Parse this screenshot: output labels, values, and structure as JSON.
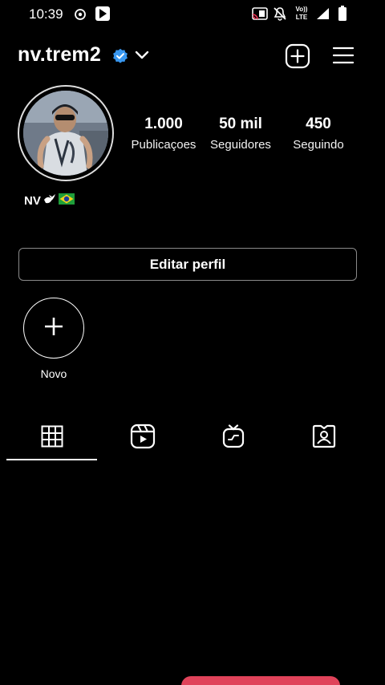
{
  "status_bar": {
    "time": "10:39",
    "icons": [
      "instagram-circle-icon",
      "play-store-icon",
      "cast-icon",
      "mute-icon",
      "volte-icon",
      "signal-icon",
      "battery-icon"
    ],
    "volte_top": "Vo))",
    "volte_bottom": "LTE"
  },
  "header": {
    "username": "nv.trem2",
    "verified": true,
    "icons": [
      "verified-badge-icon",
      "chevron-down-icon",
      "add-post-icon",
      "menu-icon"
    ]
  },
  "profile": {
    "stats": [
      {
        "value": "1.000",
        "label": "Publicaçoes"
      },
      {
        "value": "50 mil",
        "label": "Seguidores"
      },
      {
        "value": "450",
        "label": "Seguindo"
      }
    ],
    "bio": "NV",
    "bio_emojis": [
      "dove-emoji",
      "brazil-flag-emoji"
    ]
  },
  "edit_profile_label": "Editar perfil",
  "highlights": {
    "new_label": "Novo"
  },
  "tabs": [
    {
      "name": "grid",
      "icon": "grid-icon",
      "active": true
    },
    {
      "name": "reels",
      "icon": "reels-icon",
      "active": false
    },
    {
      "name": "igtv",
      "icon": "igtv-icon",
      "active": false
    },
    {
      "name": "tagged",
      "icon": "tagged-icon",
      "active": false
    }
  ],
  "colors": {
    "background": "#000000",
    "verified": "#3897f0",
    "toast": "#e0435a"
  }
}
